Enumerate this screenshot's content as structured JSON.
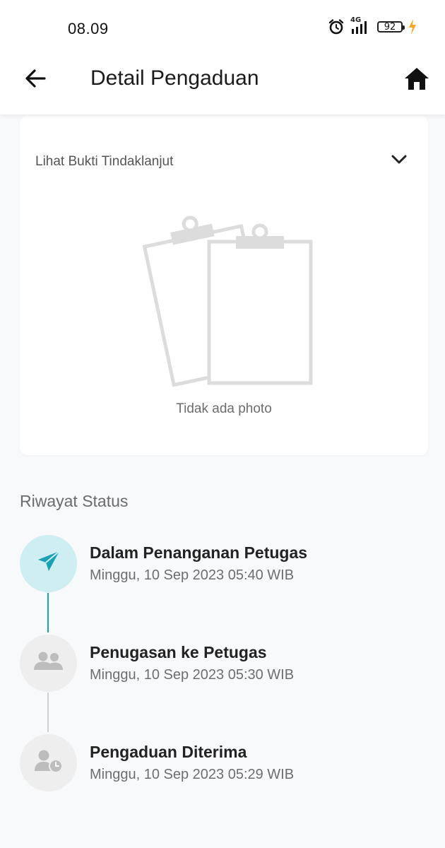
{
  "status_bar": {
    "time": "08.09",
    "network": "4G",
    "battery": "92",
    "icons": [
      "alarm-icon",
      "signal-icon",
      "battery-icon",
      "charging-bolt-icon"
    ]
  },
  "app_bar": {
    "title": "Detail Pengaduan",
    "back_icon": "arrow-left-icon",
    "home_icon": "home-icon"
  },
  "proof_section": {
    "toggle_label": "Lihat Bukti Tindaklanjut",
    "toggle_icon": "chevron-down-icon",
    "illustration": "clipboard-icon",
    "empty_text": "Tidak ada photo"
  },
  "history": {
    "heading": "Riwayat Status",
    "items": [
      {
        "title": "Dalam Penanganan Petugas",
        "datetime": "Minggu, 10 Sep 2023 05:40 WIB",
        "icon": "paper-plane-icon",
        "active": true
      },
      {
        "title": "Penugasan ke Petugas",
        "datetime": "Minggu, 10 Sep 2023 05:30 WIB",
        "icon": "users-icon",
        "active": false
      },
      {
        "title": "Pengaduan Diterima",
        "datetime": "Minggu, 10 Sep 2023 05:29 WIB",
        "icon": "user-clock-icon",
        "active": false
      }
    ]
  },
  "colors": {
    "accent": "#1aa1b3",
    "accent_light": "#cfeef2",
    "inactive_circle": "#eeeeee",
    "inactive_icon": "#bdbdbd",
    "page_background": "#f8f9fb",
    "charging": "#f5a623"
  }
}
